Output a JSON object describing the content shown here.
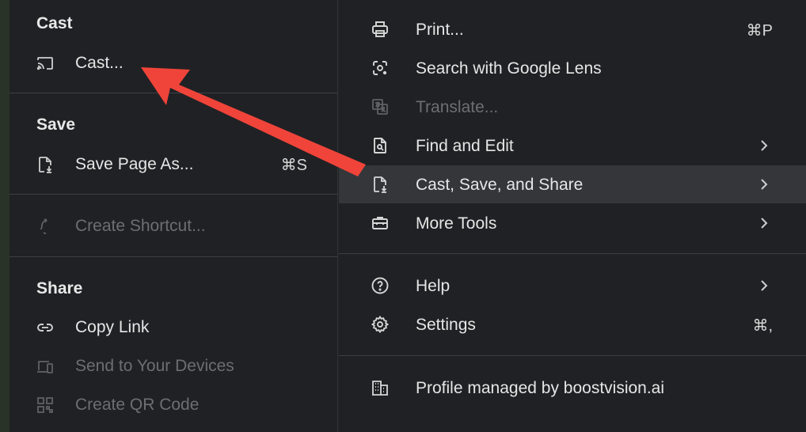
{
  "cast_save_share_submenu": {
    "cast_section": {
      "title": "Cast",
      "items": [
        {
          "label": "Cast...",
          "icon": "cast-icon",
          "enabled": true
        }
      ]
    },
    "save_section": {
      "title": "Save",
      "items": [
        {
          "label": "Save Page As...",
          "shortcut": "⌘S",
          "icon": "save-page-icon",
          "enabled": true
        }
      ]
    },
    "shortcut_section": {
      "items": [
        {
          "label": "Create Shortcut...",
          "icon": "shortcut-icon",
          "enabled": false
        }
      ]
    },
    "share_section": {
      "title": "Share",
      "items": [
        {
          "label": "Copy Link",
          "icon": "link-icon",
          "enabled": true
        },
        {
          "label": "Send to Your Devices",
          "icon": "devices-icon",
          "enabled": false
        },
        {
          "label": "Create QR Code",
          "icon": "qr-code-icon",
          "enabled": false
        }
      ]
    }
  },
  "main_menu": {
    "items": [
      {
        "label": "Print...",
        "shortcut": "⌘P",
        "icon": "print-icon",
        "enabled": true
      },
      {
        "label": "Search with Google Lens",
        "icon": "google-lens-icon",
        "enabled": true
      },
      {
        "label": "Translate...",
        "icon": "translate-icon",
        "enabled": false
      },
      {
        "label": "Find and Edit",
        "icon": "find-edit-icon",
        "enabled": true,
        "submenu": true
      },
      {
        "label": "Cast, Save, and Share",
        "icon": "cast-save-share-icon",
        "enabled": true,
        "submenu": true,
        "highlighted": true
      },
      {
        "label": "More Tools",
        "icon": "toolbox-icon",
        "enabled": true,
        "submenu": true
      },
      {
        "label": "Help",
        "icon": "help-icon",
        "enabled": true,
        "submenu": true
      },
      {
        "label": "Settings",
        "shortcut": "⌘,",
        "icon": "settings-gear-icon",
        "enabled": true
      },
      {
        "label": "Profile managed by boostvision.ai",
        "icon": "building-icon",
        "enabled": true
      }
    ]
  },
  "annotation": {
    "arrow_color": "#f0443a"
  },
  "colors": {
    "menu_bg": "#202124",
    "hover_bg": "#34363a",
    "text": "#e6e6e6",
    "disabled_text": "#6c6e70"
  }
}
